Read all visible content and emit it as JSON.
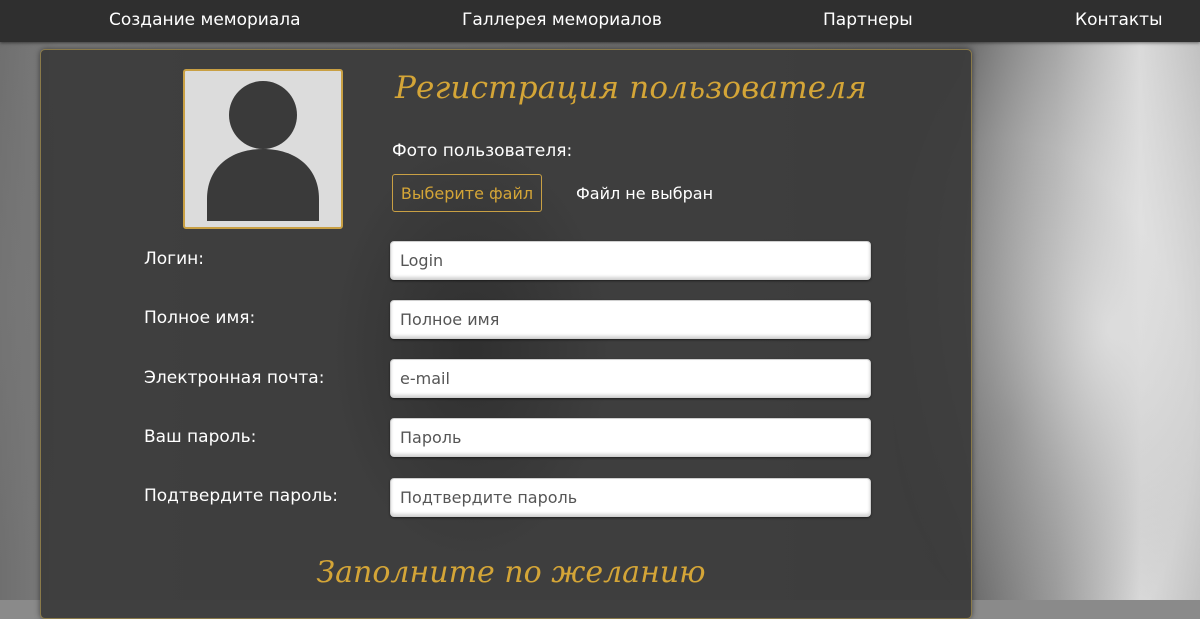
{
  "nav": {
    "items": [
      "Создание мемориала",
      "Галлерея мемориалов",
      "Партнеры",
      "Контакты"
    ]
  },
  "colors": {
    "accent": "#d4a537",
    "panel": "#3a3a3a",
    "nav": "#2f2f2f"
  },
  "form": {
    "title": "Регистрация пользователя",
    "avatar_icon": "user-silhouette-icon",
    "photo_label": "Фото пользователя:",
    "file_button": "Выберите файл",
    "file_status": "Файл не выбран",
    "fields": [
      {
        "label": "Логин:",
        "placeholder": "Login"
      },
      {
        "label": "Полное имя:",
        "placeholder": "Полное имя"
      },
      {
        "label": "Электронная почта:",
        "placeholder": "e-mail"
      },
      {
        "label": "Ваш пароль:",
        "placeholder": "Пароль"
      },
      {
        "label": "Подтвердите пароль:",
        "placeholder": "Подтвердите пароль"
      }
    ],
    "optional_title": "Заполните по желанию"
  }
}
